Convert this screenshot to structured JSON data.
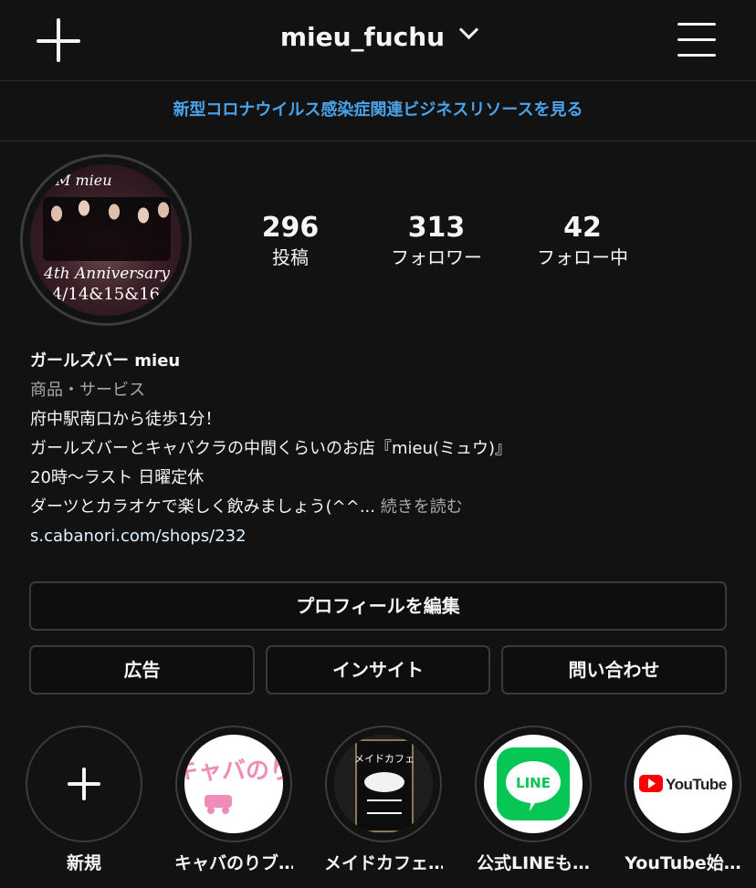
{
  "header": {
    "username": "mieu_fuchu"
  },
  "banner": {
    "text": "新型コロナウイルス感染症関連ビジネスリソースを見る"
  },
  "avatar": {
    "logo": "M mieu",
    "anniversary": "4th Anniversary",
    "dates": "4/14&15&16"
  },
  "stats": [
    {
      "value": "296",
      "label": "投稿"
    },
    {
      "value": "313",
      "label": "フォロワー"
    },
    {
      "value": "42",
      "label": "フォロー中"
    }
  ],
  "bio": {
    "name": "ガールズバー mieu",
    "category": "商品・サービス",
    "line1": "府中駅南口から徒歩1分！",
    "line2": "ガールズバーとキャバクラの中間くらいのお店『mieu(ミュウ)』",
    "line3": "20時〜ラスト 日曜定休",
    "line4": "ダーツとカラオケで楽しく飲みましょう(^^...",
    "more": "続きを読む",
    "link": "s.cabanori.com/shops/232"
  },
  "buttons": {
    "edit_profile": "プロフィールを編集",
    "ads": "広告",
    "insights": "インサイト",
    "contact": "問い合わせ"
  },
  "highlights": [
    {
      "label": "新規",
      "thumb_text": ""
    },
    {
      "label": "キャバのりブ…",
      "thumb_text": "キャバのり"
    },
    {
      "label": "メイドカフェ…",
      "thumb_text": "メイドカフェ"
    },
    {
      "label": "公式LINEも…",
      "thumb_text": "LINE"
    },
    {
      "label": "YouTube始…",
      "thumb_text": "YouTube"
    }
  ],
  "colors": {
    "background": "#121212",
    "link_blue": "#4aa3ea",
    "line_green": "#06c755",
    "youtube_red": "#ff0000"
  }
}
